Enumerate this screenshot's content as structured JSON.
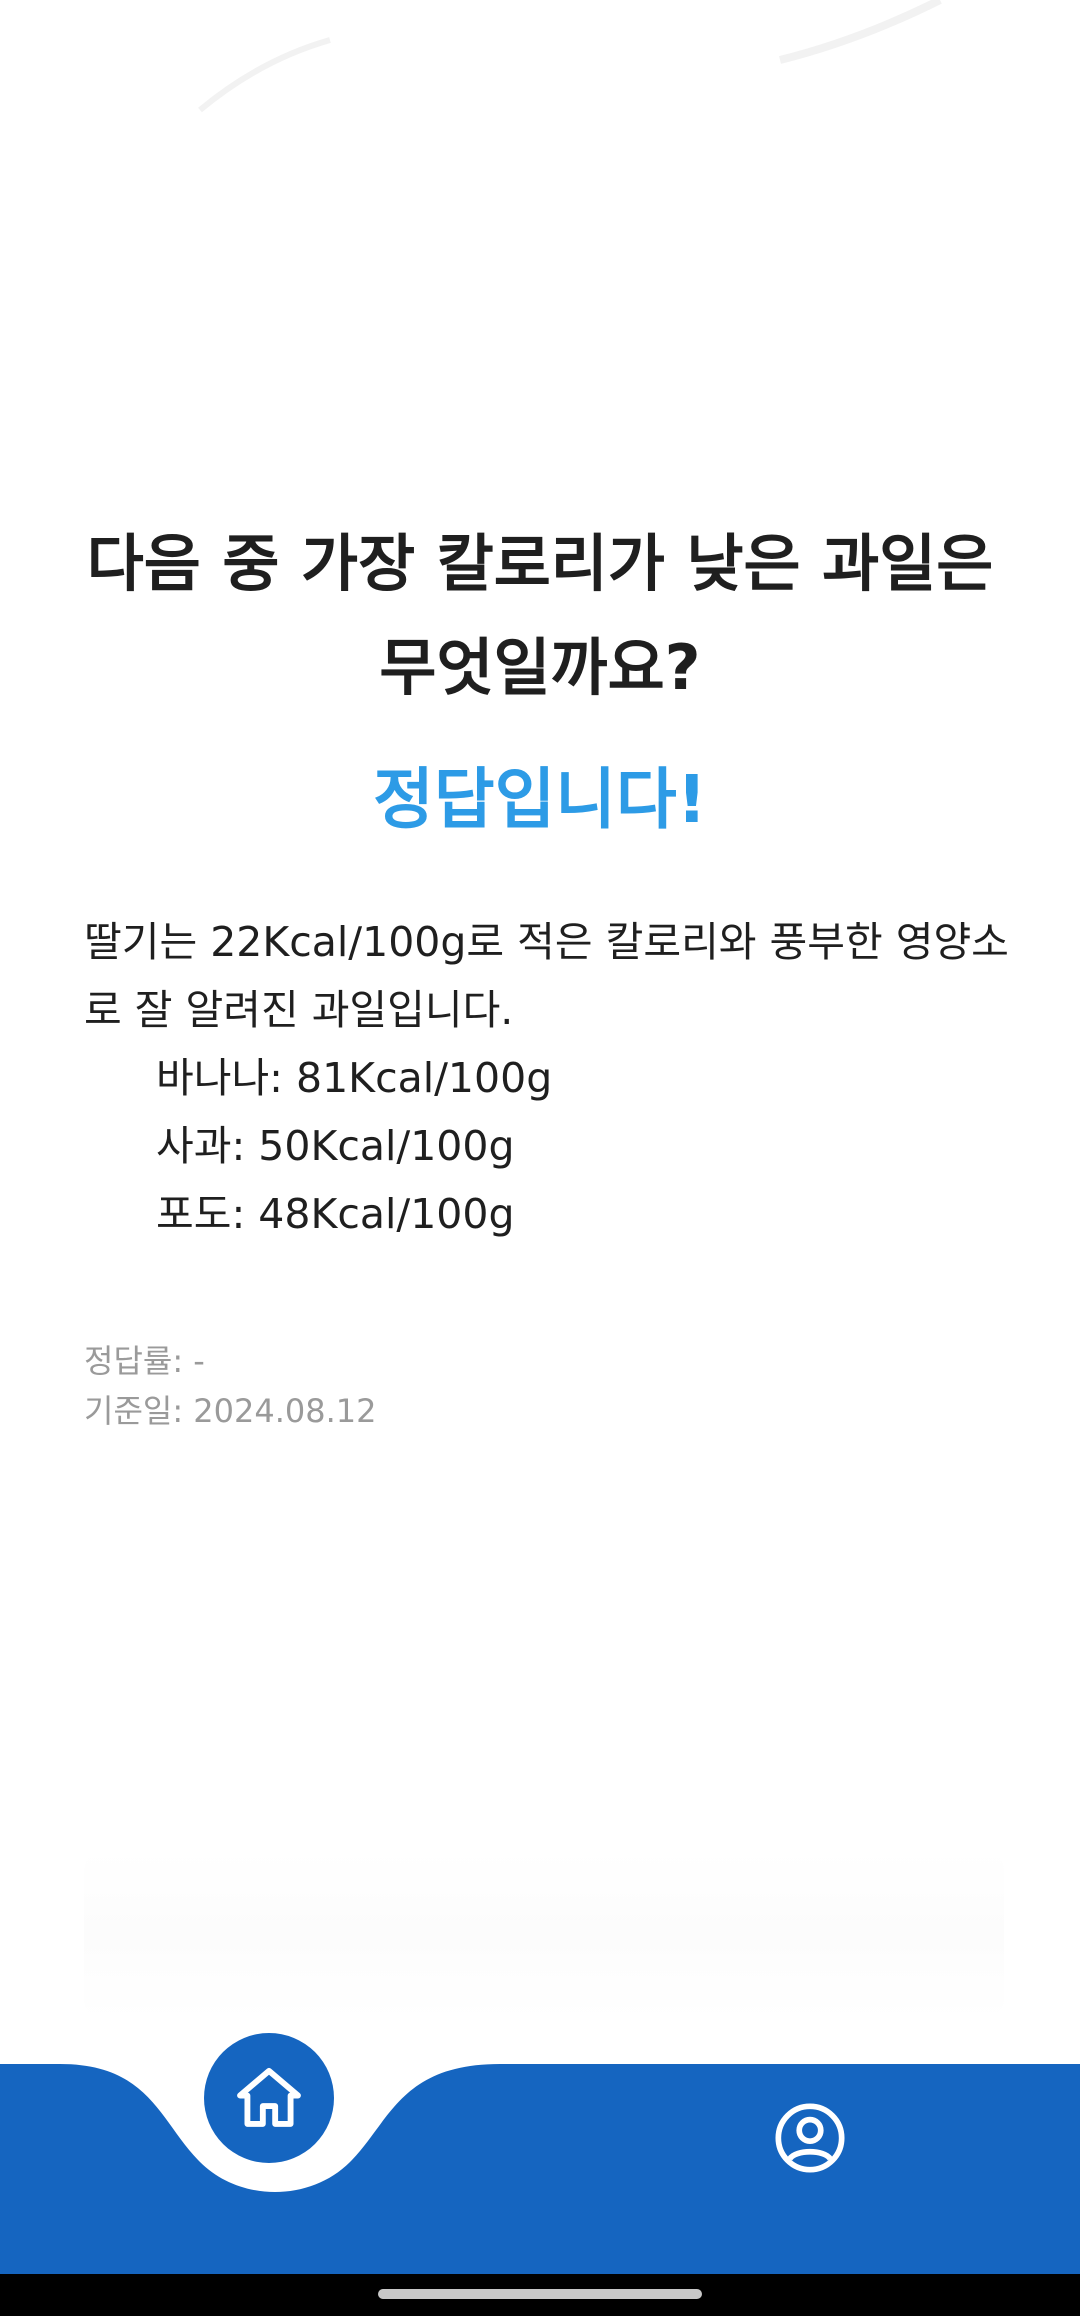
{
  "quiz": {
    "question": "다음 중 가장 칼로리가 낮은 과일은 무엇일까요?",
    "result": "정답입니다!",
    "explanation": "딸기는 22Kcal/100g로 적은 칼로리와 풍부한 영양소로 잘 알려진 과일입니다.",
    "options": [
      "바나나: 81Kcal/100g",
      "사과: 50Kcal/100g",
      "포도: 48Kcal/100g"
    ]
  },
  "stats": {
    "accuracy": "정답률: -",
    "date": "기준일: 2024.08.12"
  },
  "nav": {
    "items": [
      {
        "icon": "home-icon",
        "active": true
      },
      {
        "icon": "profile-icon",
        "active": false
      }
    ]
  },
  "colors": {
    "accent_blue": "#1565c0",
    "correct_blue": "#2d9be6",
    "text": "#1f1f1f",
    "muted": "#9a9a9a"
  }
}
